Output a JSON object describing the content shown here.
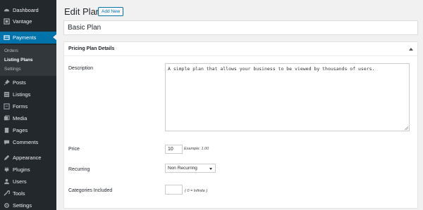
{
  "sidebar": {
    "items": [
      {
        "label": "Dashboard",
        "icon": "dashboard-icon"
      },
      {
        "label": "Vantage",
        "icon": "vantage-icon"
      },
      {
        "label": "Payments",
        "icon": "payments-icon"
      },
      {
        "label": "Posts",
        "icon": "pin-icon"
      },
      {
        "label": "Listings",
        "icon": "listings-icon"
      },
      {
        "label": "Forms",
        "icon": "forms-icon"
      },
      {
        "label": "Media",
        "icon": "media-icon"
      },
      {
        "label": "Pages",
        "icon": "pages-icon"
      },
      {
        "label": "Comments",
        "icon": "comments-icon"
      },
      {
        "label": "Appearance",
        "icon": "appearance-icon"
      },
      {
        "label": "Plugins",
        "icon": "plugins-icon"
      },
      {
        "label": "Users",
        "icon": "users-icon"
      },
      {
        "label": "Tools",
        "icon": "tools-icon"
      },
      {
        "label": "Settings",
        "icon": "settings-icon"
      }
    ],
    "submenu": [
      "Orders",
      "Listing Plans",
      "Settings"
    ]
  },
  "header": {
    "title": "Edit Plan",
    "add_new_label": "Add New"
  },
  "plan_title": "Basic Plan",
  "panel": {
    "title": "Pricing Plan Details",
    "description_label": "Description",
    "description_value": "A simple plan that allows your business to be viewed by thousands of users.",
    "price_label": "Price",
    "price_value": "10",
    "price_hint": "Example: 1.00",
    "recurring_label": "Recurring",
    "recurring_value": "Non Recurring",
    "categories_label": "Categories Included",
    "categories_value": "",
    "categories_hint": "( 0 = Infinite )"
  },
  "colors": {
    "sidebar_bg": "#23282d",
    "active_bg": "#0073aa",
    "page_bg": "#f1f1f1"
  }
}
